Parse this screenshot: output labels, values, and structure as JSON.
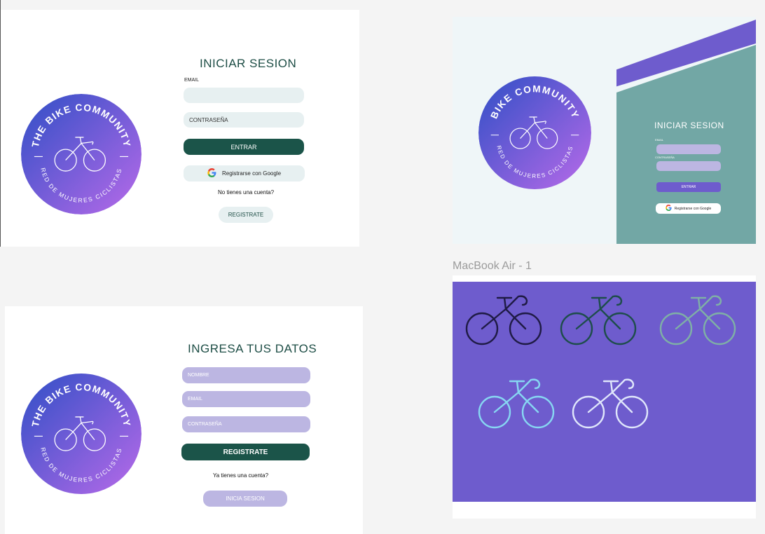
{
  "logo": {
    "arc_top": "THE BIKE COMMUNITY",
    "arc_bottom": "RED DE MUJERES CICLISTAS",
    "arc_top_alt": "BIKE COMMUNITY",
    "colors": {
      "start": "#3d50c8",
      "end": "#b265e8"
    }
  },
  "login": {
    "title": "INICIAR SESION",
    "email_label": "EMAIL",
    "password_placeholder": "CONTRASEÑA",
    "enter_label": "ENTRAR",
    "google_label": "Registrarse con Google",
    "no_account": "No tienes una cuenta?",
    "register_label": "REGISTRATE"
  },
  "register": {
    "title": "INGRESA TUS DATOS",
    "name_placeholder": "NOMBRE",
    "email_placeholder": "EMAIL",
    "password_placeholder": "CONTRASEÑA",
    "register_label": "REGISTRATE",
    "have_account": "Ya tienes una cuenta?",
    "login_label": "INICIA SESION"
  },
  "login_alt": {
    "title": "INICIAR SESION",
    "email_label": "EMAIL",
    "password_label": "CONTRASEÑA",
    "enter_label": "ENTRAR",
    "google_label": "Registrarse con Google"
  },
  "macbook": {
    "frame_name": "MacBook Air - 1",
    "bike_colors": [
      "#1f1b45",
      "#1e4d4b",
      "#7fb0a6",
      "#87d7f2",
      "#dfe6fb"
    ]
  },
  "colors": {
    "dark_green": "#1b5449",
    "light_field": "#e7f0f1",
    "lavender": "#bcb6e2",
    "purple": "#6e5ccd",
    "teal": "#72a7a5"
  }
}
